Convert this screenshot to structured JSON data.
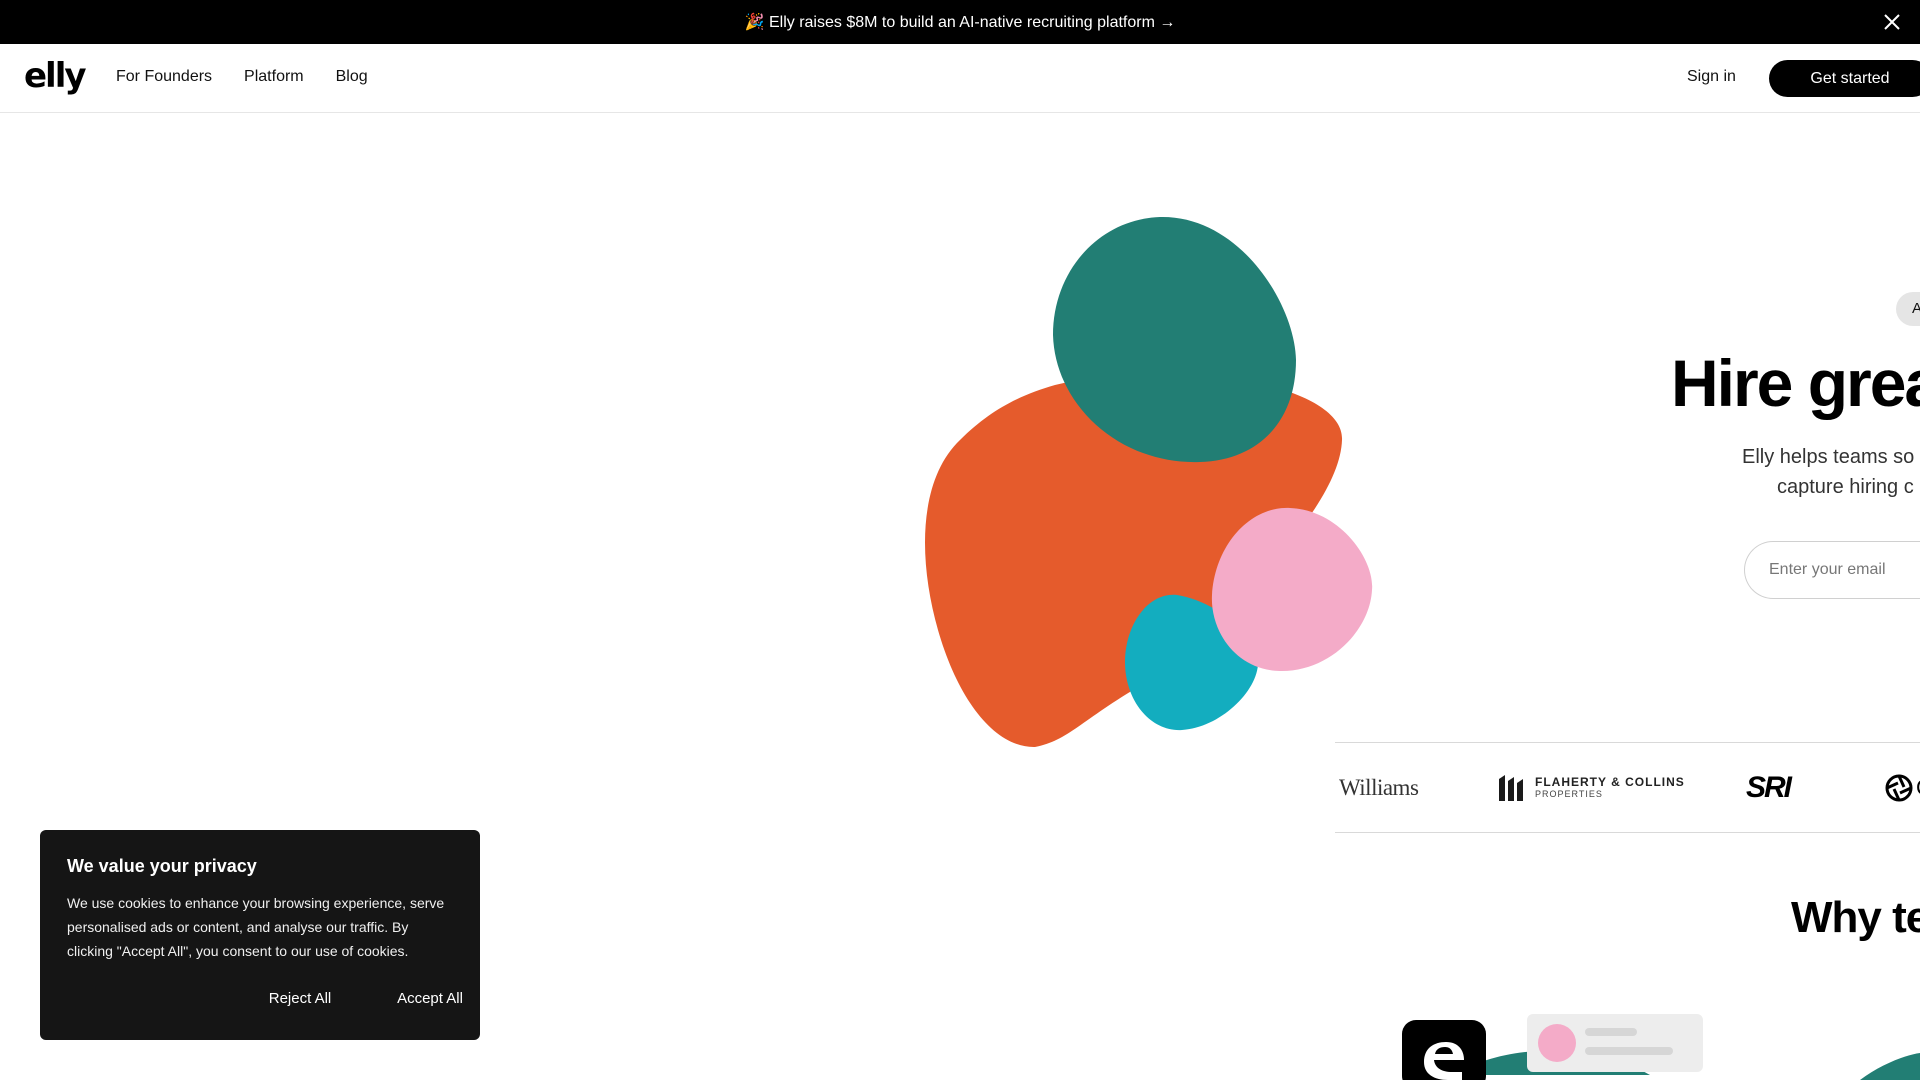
{
  "announcement": {
    "text": "🎉 Elly raises $8M to build an AI-native recruiting platform →",
    "close_icon": "close-icon"
  },
  "nav": {
    "logo": "elly",
    "links": [
      "For Founders",
      "Platform",
      "Blog"
    ],
    "sign_in": "Sign in",
    "get_started": "Get started"
  },
  "hero": {
    "badge": "A",
    "title": "Hire grea",
    "subtitle_line1": "Elly helps teams so",
    "subtitle_line2": "capture hiring c",
    "email_placeholder": "Enter your email"
  },
  "logos": {
    "williams": "Williams",
    "flaherty_line1": "FLAHERTY & COLLINS",
    "flaherty_line2": "PROPERTIES",
    "sri": "SRI",
    "partial_letter": "C"
  },
  "why": {
    "title": "Why te"
  },
  "cookie": {
    "title": "We value your privacy",
    "body": "We use cookies to enhance your browsing experience, serve personalised ads or content, and analyse our traffic. By clicking \"Accept All\", you consent to our use of cookies.",
    "reject": "Reject All",
    "accept": "Accept All"
  },
  "colors": {
    "orange": "#E55B2C",
    "teal": "#227E74",
    "pink": "#F4ABC8",
    "cyan": "#13ADBF",
    "dark": "#151515"
  }
}
